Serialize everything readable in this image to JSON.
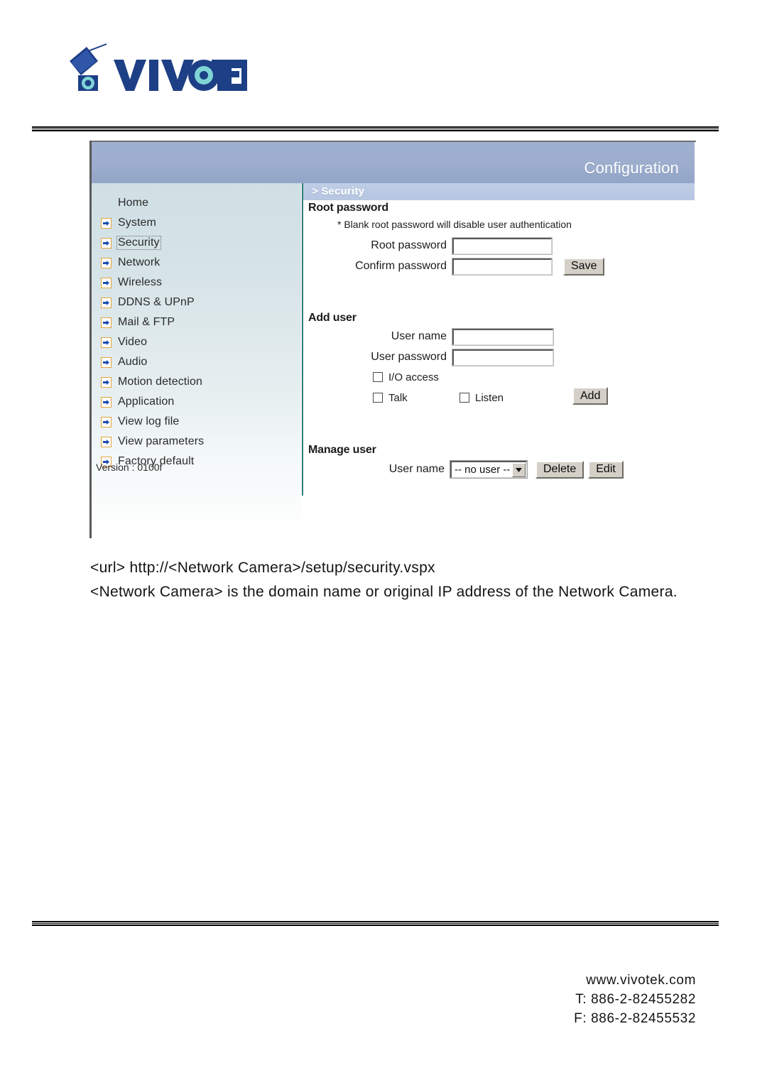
{
  "brand": {
    "logo_text": "VIVOTEK",
    "logo_icon": "vivotek-camera-logo"
  },
  "panel": {
    "header_title": "Configuration",
    "breadcrumb": "> Security"
  },
  "sidebar": {
    "items": [
      {
        "label": "Home",
        "icon": null,
        "selected": false
      },
      {
        "label": "System",
        "icon": "arrow-right-icon",
        "selected": false
      },
      {
        "label": "Security",
        "icon": "arrow-right-icon",
        "selected": true
      },
      {
        "label": "Network",
        "icon": "arrow-right-icon",
        "selected": false
      },
      {
        "label": "Wireless",
        "icon": "arrow-right-icon",
        "selected": false
      },
      {
        "label": "DDNS & UPnP",
        "icon": "arrow-right-icon",
        "selected": false
      },
      {
        "label": "Mail & FTP",
        "icon": "arrow-right-icon",
        "selected": false
      },
      {
        "label": "Video",
        "icon": "arrow-right-icon",
        "selected": false
      },
      {
        "label": "Audio",
        "icon": "arrow-right-icon",
        "selected": false
      },
      {
        "label": "Motion detection",
        "icon": "arrow-right-icon",
        "selected": false
      },
      {
        "label": "Application",
        "icon": "arrow-right-icon",
        "selected": false
      },
      {
        "label": "View log file",
        "icon": "arrow-right-icon",
        "selected": false
      },
      {
        "label": "View parameters",
        "icon": "arrow-right-icon",
        "selected": false
      },
      {
        "label": "Factory default",
        "icon": "arrow-right-icon",
        "selected": false
      }
    ],
    "version": "Version : 0100f"
  },
  "root_password": {
    "title": "Root password",
    "hint": "* Blank root password will disable user authentication",
    "password_label": "Root password",
    "password_value": "",
    "confirm_label": "Confirm password",
    "confirm_value": "",
    "save_label": "Save"
  },
  "add_user": {
    "title": "Add user",
    "username_label": "User name",
    "username_value": "",
    "password_label": "User password",
    "password_value": "",
    "io_access_label": "I/O access",
    "io_access_checked": false,
    "talk_label": "Talk",
    "talk_checked": false,
    "listen_label": "Listen",
    "listen_checked": false,
    "add_label": "Add"
  },
  "manage_user": {
    "title": "Manage user",
    "username_label": "User name",
    "selected_user": "-- no user --",
    "options": [
      "-- no user --"
    ],
    "delete_label": "Delete",
    "edit_label": "Edit"
  },
  "body_text": {
    "line1": "<url> http://<Network Camera>/setup/security.vspx",
    "line2": "<Network Camera> is the domain name or original IP address of the Network Camera."
  },
  "footer": {
    "website": "www.vivotek.com",
    "tel": "T: 886-2-82455282",
    "fax": "F: 886-2-82455532"
  },
  "colors": {
    "header_blue": "#9cadcd",
    "breadcrumb_blue": "#b7c6e1",
    "sidebar_top": "#cfdfe4",
    "divider_teal": "#2f7d77",
    "arrow_orange": "#e2a33c",
    "button_face": "#d4d0c8"
  }
}
